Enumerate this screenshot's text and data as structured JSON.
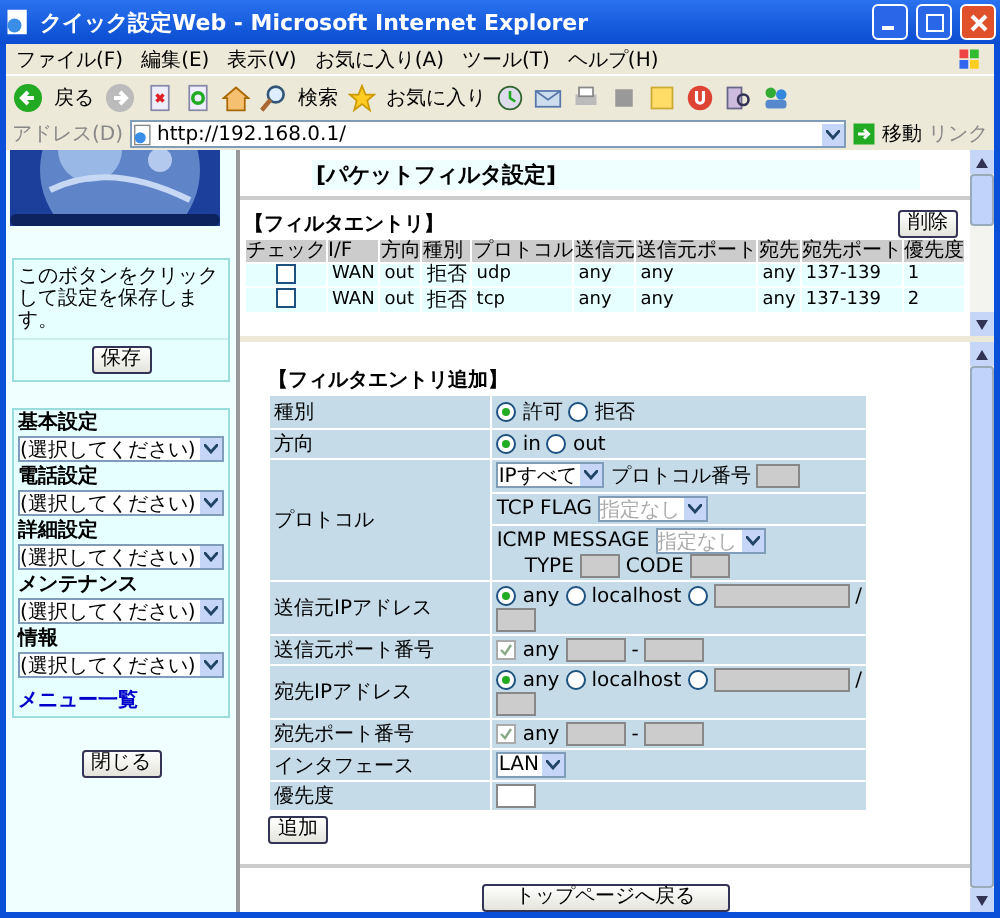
{
  "window": {
    "title": "クイック設定Web - Microsoft Internet Explorer"
  },
  "menu": [
    "ファイル(F)",
    "編集(E)",
    "表示(V)",
    "お気に入り(A)",
    "ツール(T)",
    "ヘルプ(H)"
  ],
  "toolbar": {
    "back": "戻る",
    "search": "検索",
    "favorites": "お気に入り"
  },
  "address": {
    "label": "アドレス(D)",
    "url": "http://192.168.0.1/",
    "go": "移動",
    "links": "リンク"
  },
  "sidebar": {
    "note": "このボタンをクリックして設定を保存します。",
    "save_button": "保存",
    "menus": [
      {
        "label": "基本設定",
        "placeholder": "(選択してください)"
      },
      {
        "label": "電話設定",
        "placeholder": "(選択してください)"
      },
      {
        "label": "詳細設定",
        "placeholder": "(選択してください)"
      },
      {
        "label": "メンテナンス",
        "placeholder": "(選択してください)"
      },
      {
        "label": "情報",
        "placeholder": "(選択してください)"
      }
    ],
    "menu_list_link": "メニュー一覧",
    "close_button": "閉じる"
  },
  "filter_list": {
    "title": "[パケットフィルタ設定]",
    "section": "【フィルタエントリ】",
    "delete_button": "削除",
    "check_column": "チェック",
    "columns": [
      "I/F",
      "方向",
      "種別",
      "プロトコル",
      "送信元",
      "送信元ポート",
      "宛先",
      "宛先ポート",
      "優先度"
    ],
    "rows": [
      {
        "checked": false,
        "cells": [
          "WAN",
          "out",
          "拒否",
          "udp",
          "any",
          "any",
          "any",
          "137-139",
          "1"
        ]
      },
      {
        "checked": false,
        "cells": [
          "WAN",
          "out",
          "拒否",
          "tcp",
          "any",
          "any",
          "any",
          "137-139",
          "2"
        ]
      }
    ]
  },
  "add_form": {
    "section": "【フィルタエントリ追加】",
    "type": {
      "label": "種別",
      "options": [
        {
          "label": "許可",
          "selected": true
        },
        {
          "label": "拒否",
          "selected": false
        }
      ]
    },
    "direction": {
      "label": "方向",
      "options": [
        {
          "label": "in",
          "selected": true
        },
        {
          "label": "out",
          "selected": false
        }
      ]
    },
    "protocol": {
      "label": "プロトコル",
      "select": "IPすべて",
      "number_label": "プロトコル番号",
      "tcp_flag_label": "TCP FLAG",
      "tcp_flag_select": "指定なし",
      "icmp_label": "ICMP MESSAGE",
      "icmp_select": "指定なし",
      "type_label": "TYPE",
      "code_label": "CODE"
    },
    "source_ip": {
      "label": "送信元IPアドレス",
      "options": [
        {
          "label": "any",
          "selected": true
        },
        {
          "label": "localhost",
          "selected": false
        },
        {
          "selected": false
        }
      ],
      "slash": "/"
    },
    "source_port": {
      "label": "送信元ポート番号",
      "any_label": "any",
      "any_checked": true,
      "dash": "-"
    },
    "dest_ip": {
      "label": "宛先IPアドレス",
      "options": [
        {
          "label": "any",
          "selected": true
        },
        {
          "label": "localhost",
          "selected": false
        },
        {
          "selected": false
        }
      ],
      "slash": "/"
    },
    "dest_port": {
      "label": "宛先ポート番号",
      "any_label": "any",
      "any_checked": true,
      "dash": "-"
    },
    "interface": {
      "label": "インタフェース",
      "value": "LAN"
    },
    "priority": {
      "label": "優先度"
    },
    "add_button": "追加"
  },
  "back_button": "トップページへ戻る"
}
